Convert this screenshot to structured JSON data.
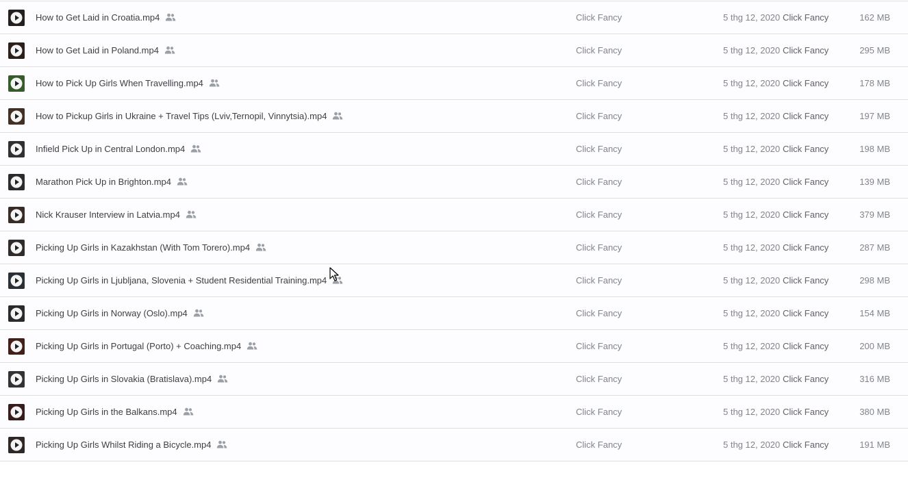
{
  "colors": {
    "row_background": "#fdfcff",
    "divider": "#e0e0e0",
    "name_text": "#3c4043",
    "secondary_text": "#80868b"
  },
  "files": [
    {
      "name": "How to Get Laid in Croatia.mp4",
      "owner": "Click Fancy",
      "modified": "5 thg 12, 2020",
      "modified_by": "Click Fancy",
      "size": "162 MB",
      "thumb_color": "#2e2a28",
      "icon": "shared-people-icon"
    },
    {
      "name": "How to Get Laid in Poland.mp4",
      "owner": "Click Fancy",
      "modified": "5 thg 12, 2020",
      "modified_by": "Click Fancy",
      "size": "295 MB",
      "thumb_color": "#3a2a26",
      "icon": "shared-people-icon"
    },
    {
      "name": "How to Pick Up Girls When Travelling.mp4",
      "owner": "Click Fancy",
      "modified": "5 thg 12, 2020",
      "modified_by": "Click Fancy",
      "size": "178 MB",
      "thumb_color": "#4a7a3a",
      "icon": "shared-people-icon"
    },
    {
      "name": "How to Pickup Girls in Ukraine + Travel Tips (Lviv,Ternopil, Vinnytsia).mp4",
      "owner": "Click Fancy",
      "modified": "5 thg 12, 2020",
      "modified_by": "Click Fancy",
      "size": "197 MB",
      "thumb_color": "#5a4030",
      "icon": "shared-people-icon"
    },
    {
      "name": "Infield Pick Up in Central London.mp4",
      "owner": "Click Fancy",
      "modified": "5 thg 12, 2020",
      "modified_by": "Click Fancy",
      "size": "198 MB",
      "thumb_color": "#404040",
      "icon": "shared-people-icon"
    },
    {
      "name": "Marathon Pick Up in Brighton.mp4",
      "owner": "Click Fancy",
      "modified": "5 thg 12, 2020",
      "modified_by": "Click Fancy",
      "size": "139 MB",
      "thumb_color": "#3a3a3a",
      "icon": "shared-people-icon"
    },
    {
      "name": "Nick Krauser Interview in Latvia.mp4",
      "owner": "Click Fancy",
      "modified": "5 thg 12, 2020",
      "modified_by": "Click Fancy",
      "size": "379 MB",
      "thumb_color": "#4a3a34",
      "icon": "shared-people-icon"
    },
    {
      "name": "Picking Up Girls in Kazakhstan (With Tom Torero).mp4",
      "owner": "Click Fancy",
      "modified": "5 thg 12, 2020",
      "modified_by": "Click Fancy",
      "size": "287 MB",
      "thumb_color": "#3e3a38",
      "icon": "shared-people-icon"
    },
    {
      "name": "Picking Up Girls in Ljubljana, Slovenia + Student Residential Training.mp4",
      "owner": "Click Fancy",
      "modified": "5 thg 12, 2020",
      "modified_by": "Click Fancy",
      "size": "298 MB",
      "thumb_color": "#3a4048",
      "icon": "shared-people-icon"
    },
    {
      "name": "Picking Up Girls in Norway (Oslo).mp4",
      "owner": "Click Fancy",
      "modified": "5 thg 12, 2020",
      "modified_by": "Click Fancy",
      "size": "154 MB",
      "thumb_color": "#383838",
      "icon": "shared-people-icon"
    },
    {
      "name": "Picking Up Girls in Portugal (Porto) + Coaching.mp4",
      "owner": "Click Fancy",
      "modified": "5 thg 12, 2020",
      "modified_by": "Click Fancy",
      "size": "200 MB",
      "thumb_color": "#5a2a22",
      "icon": "shared-people-icon"
    },
    {
      "name": "Picking Up Girls in Slovakia (Bratislava).mp4",
      "owner": "Click Fancy",
      "modified": "5 thg 12, 2020",
      "modified_by": "Click Fancy",
      "size": "316 MB",
      "thumb_color": "#444444",
      "icon": "shared-people-icon"
    },
    {
      "name": "Picking Up Girls in the Balkans.mp4",
      "owner": "Click Fancy",
      "modified": "5 thg 12, 2020",
      "modified_by": "Click Fancy",
      "size": "380 MB",
      "thumb_color": "#4a2628",
      "icon": "shared-people-icon"
    },
    {
      "name": "Picking Up Girls Whilst Riding a Bicycle.mp4",
      "owner": "Click Fancy",
      "modified": "5 thg 12, 2020",
      "modified_by": "Click Fancy",
      "size": "191 MB",
      "thumb_color": "#3c3632",
      "icon": "shared-people-icon"
    }
  ]
}
